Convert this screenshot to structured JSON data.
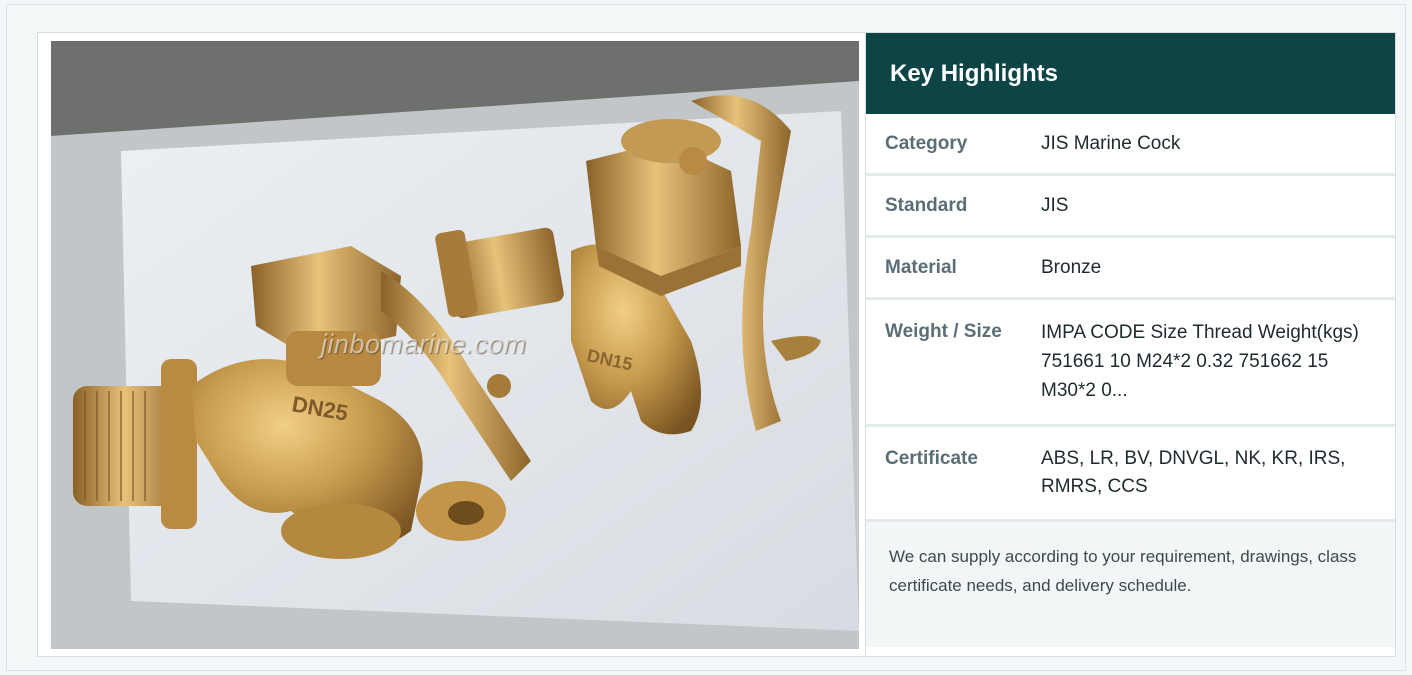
{
  "photo": {
    "alt": "JIS Marine Cock bronze valves",
    "watermark": "jinbomarine.com",
    "casting_marks": [
      "DN25",
      "DN15"
    ]
  },
  "highlights": {
    "title": "Key Highlights",
    "rows": [
      {
        "label": "Category",
        "value": "JIS Marine Cock"
      },
      {
        "label": "Standard",
        "value": "JIS"
      },
      {
        "label": "Material",
        "value": "Bronze"
      },
      {
        "label": "Weight / Size",
        "value": "IMPA CODE Size Thread Weight(kgs) 751661 10 M24*2 0.32 751662 15 M30*2 0..."
      },
      {
        "label": "Certificate",
        "value": "ABS, LR, BV, DNVGL, NK, KR, IRS, RMRS, CCS"
      }
    ],
    "note": "We can supply according to your requirement, drawings, class certificate needs, and delivery schedule."
  },
  "colors": {
    "header_bg": "#0d4546",
    "page_bg": "#f3f7f8",
    "label_text": "#5b6e75",
    "bronze": "#b8893e"
  }
}
